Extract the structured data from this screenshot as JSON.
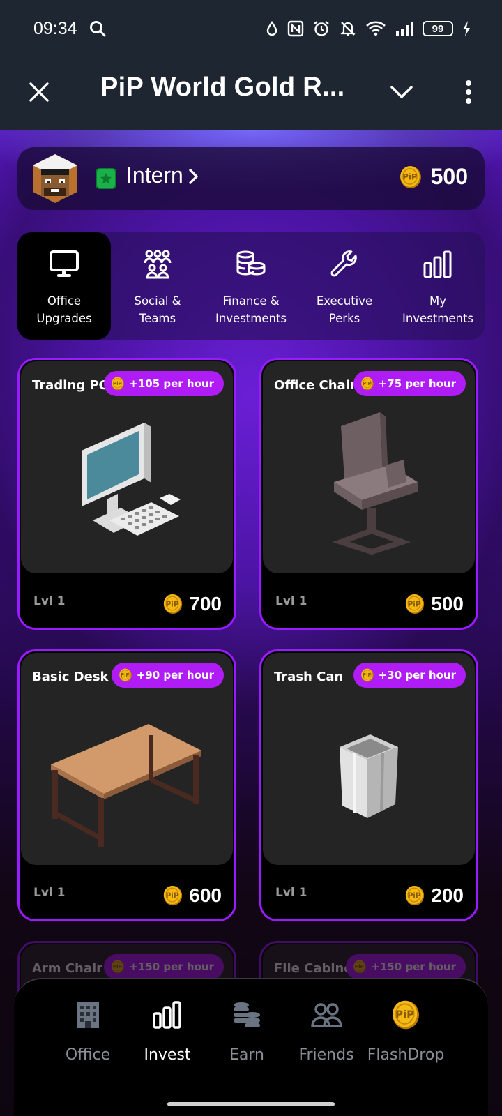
{
  "status_bar": {
    "time": "09:34",
    "battery": "99"
  },
  "app_bar": {
    "title": "PiP World Gold R..."
  },
  "profile": {
    "rank": "Intern",
    "balance": "500"
  },
  "tabs": [
    {
      "label": "Office\nUpgrades",
      "icon": "monitor-icon",
      "active": true
    },
    {
      "label": "Social &\nTeams",
      "icon": "people-group-icon",
      "active": false
    },
    {
      "label": "Finance &\nInvestments",
      "icon": "coins-stack-icon",
      "active": false
    },
    {
      "label": "Executive\nPerks",
      "icon": "wrench-icon",
      "active": false
    },
    {
      "label": "My\nInvestments",
      "icon": "bar-chart-icon",
      "active": false
    }
  ],
  "cards": [
    {
      "name": "Trading PC",
      "rate": "+105 per hour",
      "level": "Lvl 1",
      "price": "700",
      "image": "computer-image"
    },
    {
      "name": "Office Chair",
      "rate": "+75 per hour",
      "level": "Lvl 1",
      "price": "500",
      "image": "office-chair-image"
    },
    {
      "name": "Basic Desk",
      "rate": "+90 per hour",
      "level": "Lvl 1",
      "price": "600",
      "image": "desk-image"
    },
    {
      "name": "Trash Can",
      "rate": "+30 per hour",
      "level": "Lvl 1",
      "price": "200",
      "image": "trash-can-image"
    },
    {
      "name": "Arm Chair",
      "rate": "+150 per hour"
    },
    {
      "name": "File Cabinet",
      "rate": "+150 per hour"
    }
  ],
  "bottom_nav": [
    {
      "label": "Office",
      "icon": "building-icon",
      "active": false
    },
    {
      "label": "Invest",
      "icon": "bar-chart-icon",
      "active": true
    },
    {
      "label": "Earn",
      "icon": "coins-stack-icon",
      "active": false
    },
    {
      "label": "Friends",
      "icon": "friends-icon",
      "active": false
    },
    {
      "label": "FlashDrop",
      "icon": "gold-coin-icon",
      "active": false
    }
  ],
  "colors": {
    "accent": "#9a1bff",
    "rate_pill": "#b01cf5",
    "bar_bg": "#1d2631",
    "coin": "#f5b914"
  }
}
